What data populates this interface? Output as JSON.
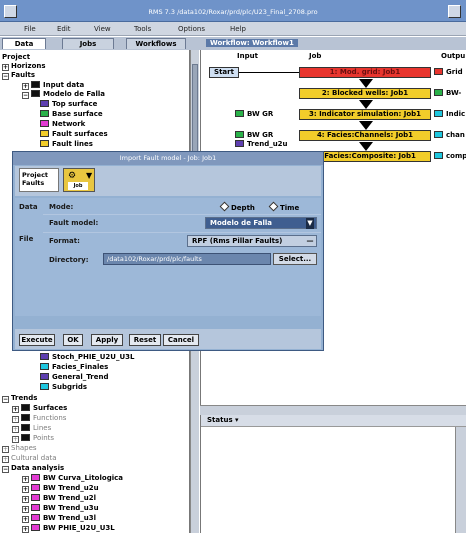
{
  "window": {
    "title": "RMS 7.3  /data102/Roxar/prd/plc/U23_Final_2708.pro"
  },
  "menu": [
    "File",
    "Edit",
    "View",
    "Tools",
    "Options",
    "Help"
  ],
  "tabs": [
    "Data",
    "Jobs",
    "Workflows"
  ],
  "tree": {
    "project": "Project",
    "horizons": "Horizons",
    "faults": "Faults",
    "input_data": "Input data",
    "modelo_de_falla": "Modelo de Falla",
    "top_surface": "Top surface",
    "base_surface": "Base surface",
    "network": "Network",
    "fault_surfaces": "Fault surfaces",
    "fault_lines": "Fault lines",
    "stoch_phie": "Stoch_PHIE_U2U_U3L",
    "facies_finales": "Facies_Finales",
    "general_trend": "General_Trend",
    "subgrids": "Subgrids",
    "trends": "Trends",
    "surfaces": "Surfaces",
    "functions": "Functions",
    "lines": "Lines",
    "points": "Points",
    "shapes": "Shapes",
    "cultural_data": "Cultural data",
    "data_analysis": "Data analysis",
    "da_items": [
      "BW Curva_Litologica",
      "BW Trend_u2u",
      "BW Trend_u2l",
      "BW Trend_u3u",
      "BW Trend_u3l",
      "BW PHIE_U2U_U3L"
    ]
  },
  "workflow": {
    "tab_label": "Workflow: Workflow1",
    "col_input": "Input",
    "col_job": "Job",
    "col_output": "Outpu",
    "start": "Start",
    "jobs": [
      "1:  Mod. grid: Job1",
      "2:  Blocked wells: Job1",
      "3:  Indicator simulation: Job1",
      "4:  Facies:Channels: Job1",
      "5:  Facies:Composite: Job1"
    ],
    "inputs": [
      "BW GR",
      "BW GR",
      "Trend_u2u"
    ],
    "outputs": [
      "Grid",
      "BW-",
      "Indic",
      "chan",
      "comp"
    ]
  },
  "status": {
    "label": "Status"
  },
  "dialog": {
    "title": "Import Fault model - Job: Job1",
    "project_label": "Project Faults",
    "job_label": "Job",
    "section_data": "Data",
    "section_file": "File",
    "mode_label": "Mode:",
    "mode_options": [
      "Depth",
      "Time"
    ],
    "fault_model_label": "Fault model:",
    "fault_model_value": "Modelo de Falla",
    "format_label": "Format:",
    "format_value": "RPF (Rms Pillar Faults)",
    "directory_label": "Directory:",
    "directory_value": "/data102/Roxar/prd/plc/faults",
    "select_label": "Select...",
    "buttons": [
      "Execute",
      "OK",
      "Apply",
      "Reset",
      "Cancel"
    ]
  },
  "colors": {
    "red_job": "#e8352e",
    "yellow_job": "#f2cd2a",
    "green": "#2ab24a",
    "cyan": "#1fc7df",
    "magenta": "#e23bd3",
    "purple": "#5e3fb0"
  }
}
